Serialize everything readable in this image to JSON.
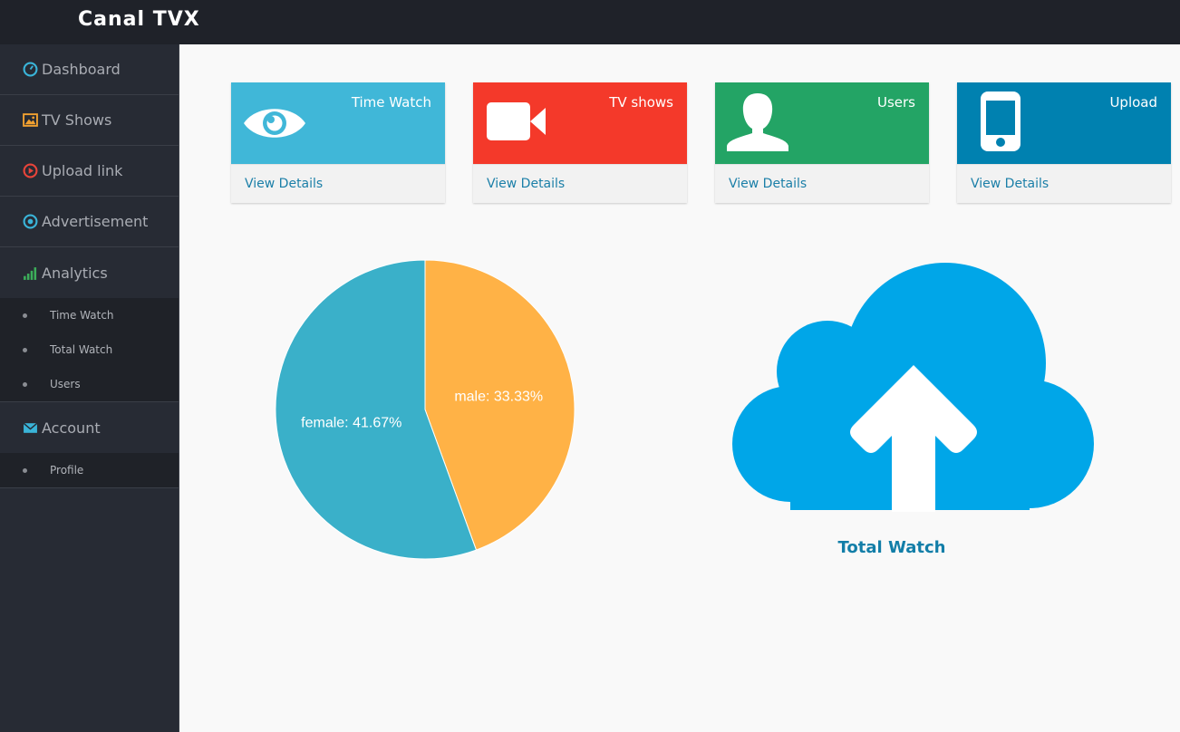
{
  "app": {
    "title": "Canal TVX"
  },
  "sidebar": {
    "items": [
      {
        "label": "Dashboard",
        "icon": "dashboard-icon",
        "color": "#3ab4d8"
      },
      {
        "label": "TV Shows",
        "icon": "image-icon",
        "color": "#f0a030"
      },
      {
        "label": "Upload link",
        "icon": "play-circle-icon",
        "color": "#e8443a"
      },
      {
        "label": "Advertisement",
        "icon": "target-icon",
        "color": "#3ab4d8"
      },
      {
        "label": "Analytics",
        "icon": "signal-bars-icon",
        "color": "#3cae5a"
      }
    ],
    "analytics_sub": [
      "Time Watch",
      "Total Watch",
      "Users"
    ],
    "account": {
      "label": "Account",
      "icon": "envelope-icon",
      "color": "#3ab4d8"
    },
    "account_sub": [
      "Profile"
    ]
  },
  "cards": [
    {
      "title": "Time Watch",
      "link": "View Details",
      "color": "#40b7d8",
      "icon": "eye-icon"
    },
    {
      "title": "TV shows",
      "link": "View Details",
      "color": "#f4392a",
      "icon": "video-camera-icon"
    },
    {
      "title": "Users",
      "link": "View Details",
      "color": "#23a465",
      "icon": "user-icon"
    },
    {
      "title": "Upload",
      "link": "View Details",
      "color": "#0081b0",
      "icon": "mobile-phone-icon"
    }
  ],
  "chart_data": {
    "type": "pie",
    "slices": [
      {
        "label": "male: 33.33%",
        "value": 33.33,
        "color": "#ffb246"
      },
      {
        "label": "female: 41.67%",
        "value": 41.67,
        "color": "#3ab0c9"
      }
    ]
  },
  "upload_panel": {
    "caption": "Total Watch",
    "icon": "cloud-upload-icon",
    "color": "#00a6e8"
  }
}
